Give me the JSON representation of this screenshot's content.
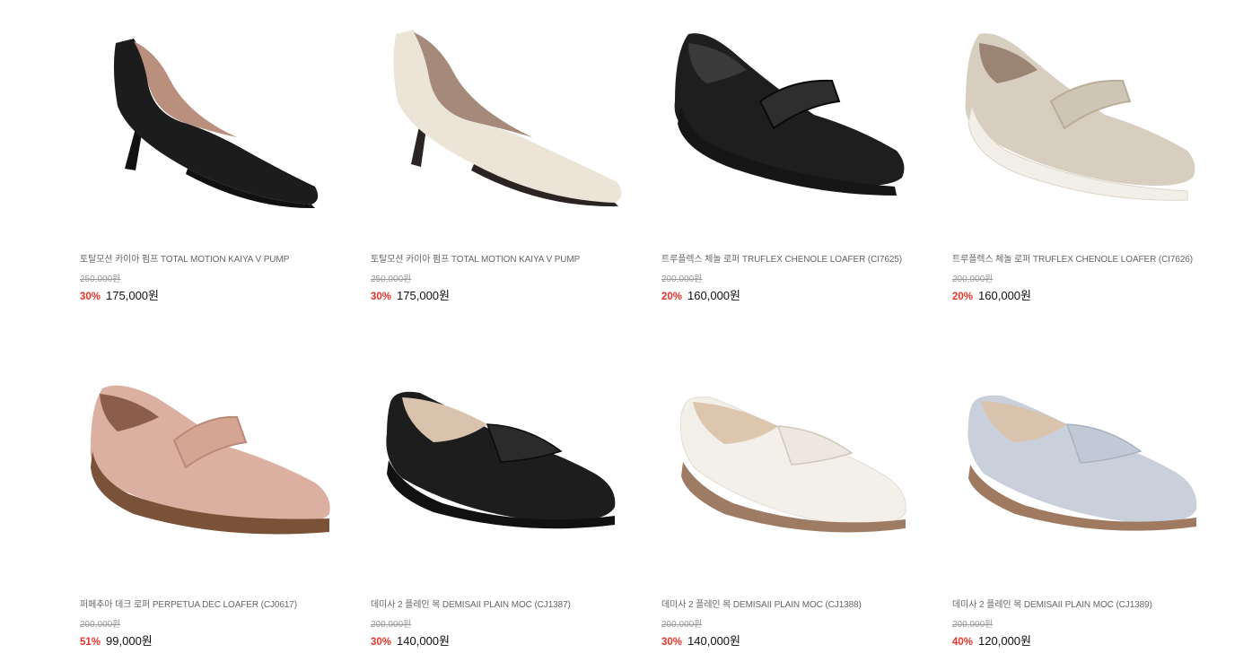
{
  "products": [
    {
      "name": "토탈모션 카이아 펌프 TOTAL MOTION KAIYA V PUMP",
      "original_price": "250,000원",
      "discount": "30%",
      "sale_price": "175,000원",
      "image": "black-pump-heel",
      "colors": {
        "upper": "#1c1c1c",
        "lining": "#b98f7e",
        "sole": "#111111"
      }
    },
    {
      "name": "토탈모션 카이아 펌프 TOTAL MOTION KAIYA V PUMP",
      "original_price": "250,000원",
      "discount": "30%",
      "sale_price": "175,000원",
      "image": "ivory-pump-heel",
      "colors": {
        "upper": "#ece4d6",
        "lining": "#a58a7b",
        "sole": "#2a2422"
      }
    },
    {
      "name": "트루플렉스 체놀 로퍼 TRUFLEX CHENOLE LOAFER (CI7625)",
      "original_price": "200,000원",
      "discount": "20%",
      "sale_price": "160,000원",
      "image": "black-penny-loafer",
      "colors": {
        "upper": "#1e1e1e",
        "lining": "#3a3a3a",
        "sole": "#161616"
      }
    },
    {
      "name": "트루플렉스 체놀 로퍼 TRUFLEX CHENOLE LOAFER (CI7626)",
      "original_price": "200,000원",
      "discount": "20%",
      "sale_price": "160,000원",
      "image": "beige-penny-loafer",
      "colors": {
        "upper": "#d7cebf",
        "lining": "#9c8474",
        "sole": "#f2efe8"
      }
    },
    {
      "name": "퍼페추아 데크 로퍼 PERPETUA DEC LOAFER (CJ0617)",
      "original_price": "200,000원",
      "discount": "51%",
      "sale_price": "99,000원",
      "image": "blush-penny-loafer",
      "colors": {
        "upper": "#dcb0a0",
        "lining": "#8a5e4b",
        "sole": "#7a5238"
      }
    },
    {
      "name": "데미사 2 플레인 목 DEMISAII PLAIN MOC (CJ1387)",
      "original_price": "200,000원",
      "discount": "30%",
      "sale_price": "140,000원",
      "image": "black-moc-flat",
      "colors": {
        "upper": "#1d1d1d",
        "lining": "#d9c3ad",
        "sole": "#111111"
      }
    },
    {
      "name": "데미사 2 플레인 목 DEMISAII PLAIN MOC (CJ1388)",
      "original_price": "200,000원",
      "discount": "30%",
      "sale_price": "140,000원",
      "image": "white-moc-flat",
      "colors": {
        "upper": "#f3f0e9",
        "lining": "#dcc6ae",
        "sole": "#9e7b63"
      }
    },
    {
      "name": "데미사 2 플레인 목 DEMISAII PLAIN MOC (CJ1389)",
      "original_price": "200,000원",
      "discount": "40%",
      "sale_price": "120,000원",
      "image": "light-blue-moc-flat",
      "colors": {
        "upper": "#c9d0dc",
        "lining": "#d9c3ad",
        "sole": "#a07a60"
      }
    }
  ]
}
